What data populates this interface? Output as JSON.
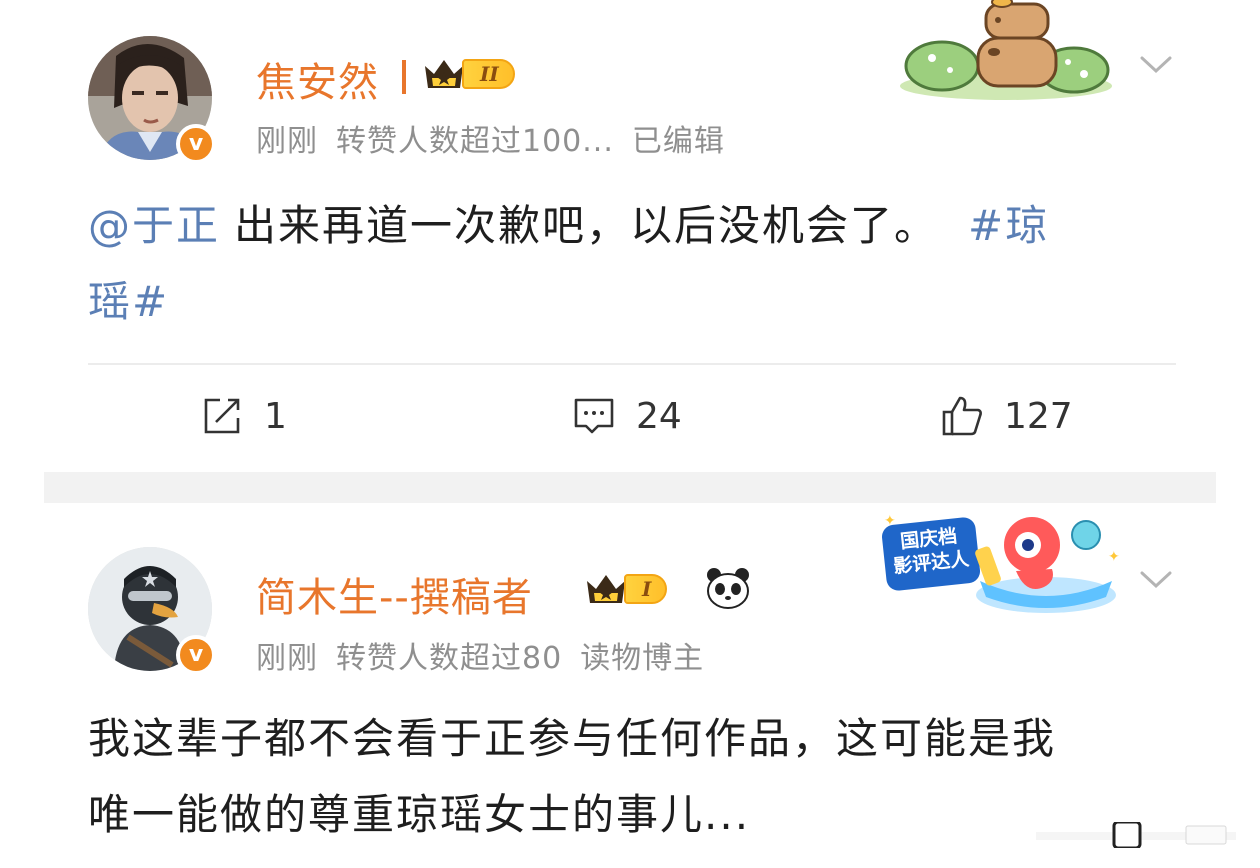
{
  "post1": {
    "username": "焦安然",
    "level": "II",
    "meta": {
      "time": "刚刚",
      "repost_info": "转赞人数超过100...",
      "edited": "已编辑"
    },
    "mention": "@于正",
    "body": "出来再道一次歉吧，以后没机会了。",
    "hashtag_a": "#琼",
    "hashtag_b": "瑶#",
    "actions": {
      "reposts": "1",
      "comments": "24",
      "likes": "127"
    }
  },
  "post2": {
    "username": "简木生--撰稿者",
    "level": "I",
    "meta": {
      "time": "刚刚",
      "repost_info": "转赞人数超过80",
      "role": "读物博主"
    },
    "line1": "我这辈子都不会看于正参与任何作品，这可能是我",
    "line2": "唯一能做的尊重琼瑶女士的事儿...",
    "sticker_text": {
      "line1": "国庆档",
      "line2": "影评达人"
    }
  },
  "verify_mark": "v",
  "colors": {
    "username": "#e8762c",
    "link": "#5b7fb5",
    "meta": "#8f8f8f",
    "verify": "#f28a1e",
    "separator": "#f2f2f2"
  },
  "icons": [
    "verified-badge-icon",
    "crown-icon",
    "chevron-down-icon",
    "repost-icon",
    "comment-icon",
    "like-icon",
    "panda-icon"
  ]
}
